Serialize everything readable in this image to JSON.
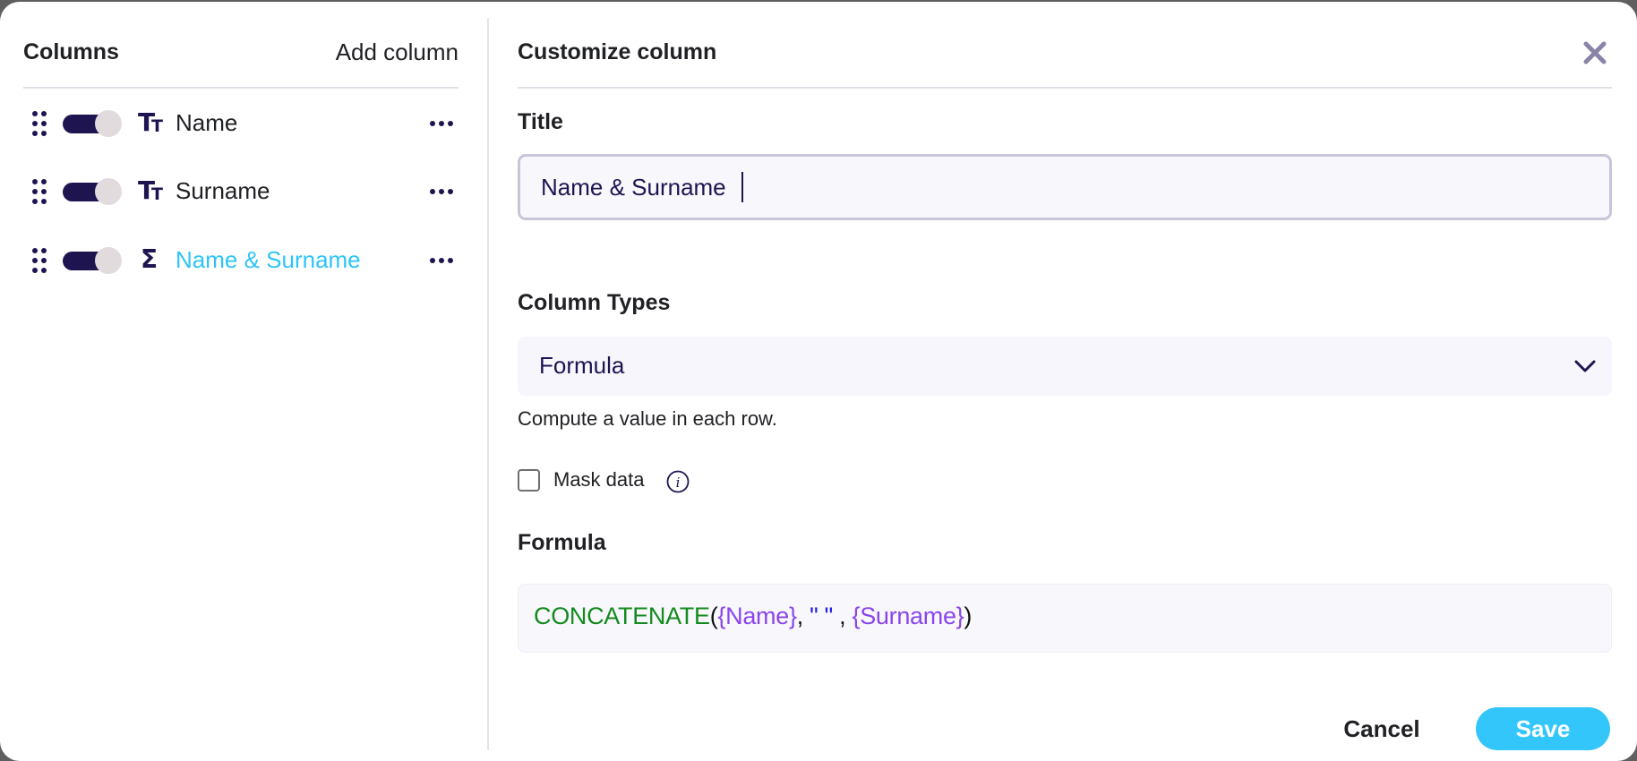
{
  "left_panel": {
    "title": "Columns",
    "add_column_label": "Add column",
    "columns": [
      {
        "label": "Name",
        "type_icon": "text-type-icon",
        "visible": true,
        "active": false
      },
      {
        "label": "Surname",
        "type_icon": "text-type-icon",
        "visible": true,
        "active": false
      },
      {
        "label": "Name & Surname",
        "type_icon": "sigma-formula-icon",
        "visible": true,
        "active": true
      }
    ]
  },
  "right_panel": {
    "title": "Customize column",
    "close_icon": "close-icon",
    "title_field": {
      "label": "Title",
      "value": "Name & Surname"
    },
    "column_types": {
      "label": "Column Types",
      "selected": "Formula",
      "help_text": "Compute a value in each row."
    },
    "mask_data": {
      "label": "Mask data",
      "checked": false
    },
    "formula": {
      "label": "Formula",
      "tokens": {
        "fn": "CONCATENATE",
        "open": "(",
        "ref1": "{Name}",
        "sep1": ", ",
        "str": "\" \"",
        "sep2": " , ",
        "ref2": "{Surname}",
        "close": ")"
      }
    },
    "buttons": {
      "cancel": "Cancel",
      "save": "Save"
    }
  },
  "colors": {
    "accent": "#33c6fb",
    "active_text": "#2ec4f7",
    "primary_dark": "#1e1550",
    "formula_function": "#138a1f",
    "formula_reference": "#8a45ec",
    "formula_string": "#1d1ae0"
  }
}
